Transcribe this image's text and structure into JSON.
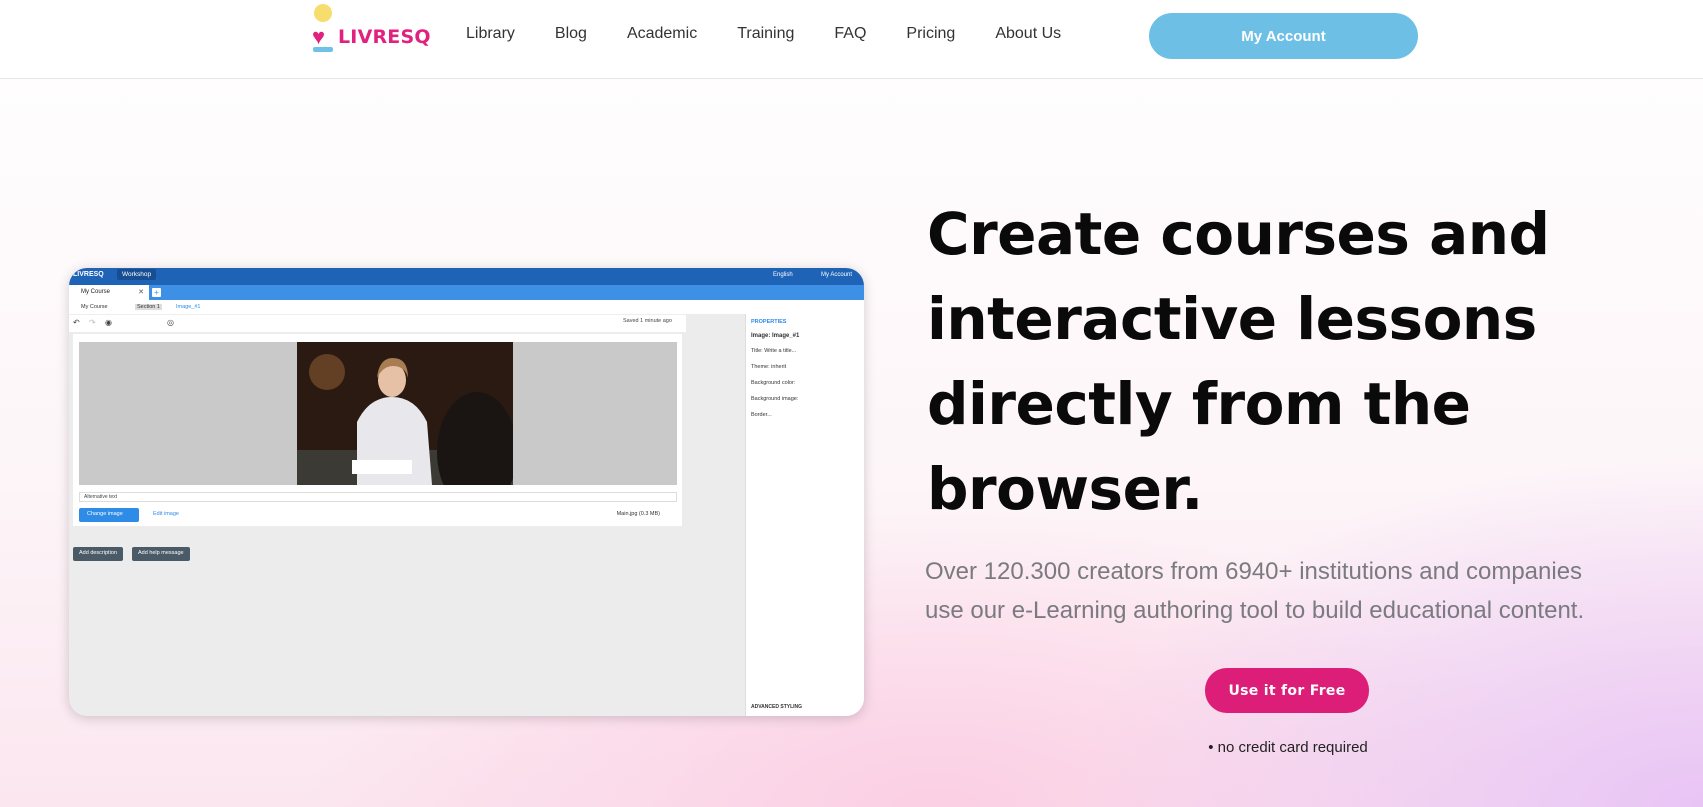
{
  "brand": {
    "name": "LIVRESQ",
    "colors": {
      "primary": "#dd1e78",
      "accent": "#6dbfe6",
      "sun": "#f7dd6e"
    }
  },
  "nav": {
    "links": [
      "Library",
      "Blog",
      "Academic",
      "Training",
      "FAQ",
      "Pricing",
      "About Us"
    ],
    "account_label": "My Account"
  },
  "hero": {
    "title_lines": [
      "Create courses and",
      "interactive lessons",
      "directly from the",
      "browser."
    ],
    "subtitle_lines": [
      "Over 120.300 creators from 6940+ institutions and companies",
      "use our e-Learning authoring tool to build educational content."
    ],
    "cta_label": "Use it for Free",
    "note": "• no credit card required"
  },
  "mockup": {
    "app_logo": "LIVRESQ",
    "workshop_label": "Workshop",
    "language": "English",
    "account": "My Account",
    "tab_label": "My Course",
    "breadcrumbs": [
      "My Course",
      "Section 1",
      "Image_#1"
    ],
    "saved_status": "Saved 1 minute ago",
    "alt_text_label": "Alternative text",
    "change_image_label": "Change image",
    "edit_image_label": "Edit image",
    "file_info": "Main.jpg (0.3 MB)",
    "add_description_label": "Add description",
    "add_help_label": "Add help message",
    "properties": {
      "heading": "PROPERTIES",
      "title": "Image: Image_#1",
      "rows": [
        "Title: Write a title...",
        "Theme: inherit",
        "Background color:",
        "Background image:",
        "Border..."
      ],
      "advanced": "ADVANCED STYLING"
    }
  }
}
